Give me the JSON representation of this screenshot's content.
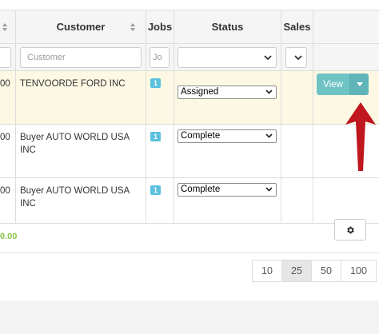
{
  "headers": {
    "customer": "Customer",
    "jobs": "Jobs",
    "status": "Status",
    "sales": "Sales"
  },
  "filters": {
    "customer_placeholder": "Customer",
    "jobs_placeholder": "Jo"
  },
  "rows": [
    {
      "amount_fragment": "00",
      "customer": "TENVOORDE FORD INC",
      "jobs": "1",
      "status": "Assigned"
    },
    {
      "amount_fragment": "00",
      "customer_line1": "Buyer AUTO WORLD USA",
      "customer_line2": "INC",
      "jobs": "1",
      "status": "Complete"
    },
    {
      "amount_fragment": "00",
      "customer_line1": "Buyer AUTO WORLD USA",
      "customer_line2": "INC",
      "jobs": "1",
      "status": "Complete"
    }
  ],
  "actions": {
    "view_label": "View"
  },
  "footer": {
    "total_fragment": "0.00"
  },
  "pagination": {
    "options": [
      "10",
      "25",
      "50",
      "100"
    ],
    "selected": "25"
  },
  "icons": {
    "sort": "sort-icon",
    "dropdown": "chevron-down-icon",
    "caret": "caret-down-icon",
    "settings": "gear-icon",
    "annotation": "red-arrow-icon"
  },
  "colors": {
    "highlight_row": "#fcf8e3",
    "view_button": "#6fc3c5",
    "badge": "#5bc0de",
    "total": "#8bc34a",
    "arrow": "#c0161e"
  }
}
